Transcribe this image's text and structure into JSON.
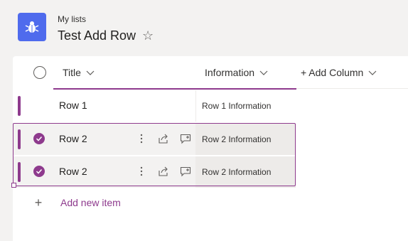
{
  "header": {
    "breadcrumb": "My lists",
    "title": "Test Add Row",
    "app_icon": "bug-icon",
    "favorite_icon": "star-icon"
  },
  "columns": {
    "title": "Title",
    "information": "Information",
    "add_column": "+ Add Column"
  },
  "rows": [
    {
      "title": "Row 1",
      "information": "Row 1 Information",
      "selected": false
    },
    {
      "title": "Row 2",
      "information": "Row 2 Information",
      "selected": true
    },
    {
      "title": "Row 2",
      "information": "Row 2 Information",
      "selected": true
    }
  ],
  "add_new_item": "Add new item",
  "colors": {
    "accent": "#8e3a8d",
    "app_icon_bg": "#4f6bed",
    "page_bg": "#f3f2f1"
  }
}
